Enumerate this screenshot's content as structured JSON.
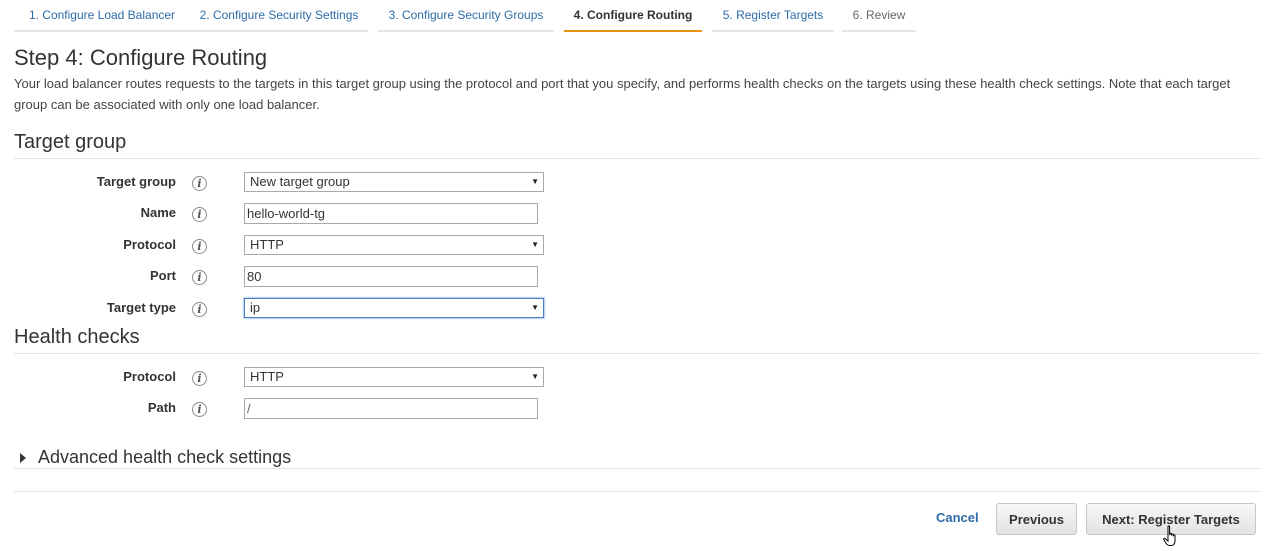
{
  "wizard": {
    "tabs": [
      {
        "label": "1. Configure Load Balancer",
        "state": "done"
      },
      {
        "label": "2. Configure Security Settings",
        "state": "done"
      },
      {
        "label": "3. Configure Security Groups",
        "state": "done"
      },
      {
        "label": "4. Configure Routing",
        "state": "active"
      },
      {
        "label": "5. Register Targets",
        "state": "next"
      },
      {
        "label": "6. Review",
        "state": "disabled"
      }
    ]
  },
  "page": {
    "title": "Step 4: Configure Routing",
    "description": "Your load balancer routes requests to the targets in this target group using the protocol and port that you specify, and performs health checks on the targets using these health check settings. Note that each target group can be associated with only one load balancer."
  },
  "target_group": {
    "section_title": "Target group",
    "fields": {
      "target_group": {
        "label": "Target group",
        "value": "New target group"
      },
      "name": {
        "label": "Name",
        "value": "hello-world-tg"
      },
      "protocol": {
        "label": "Protocol",
        "value": "HTTP"
      },
      "port": {
        "label": "Port",
        "value": "80"
      },
      "target_type": {
        "label": "Target type",
        "value": "ip"
      }
    }
  },
  "health_checks": {
    "section_title": "Health checks",
    "fields": {
      "protocol": {
        "label": "Protocol",
        "value": "HTTP"
      },
      "path": {
        "label": "Path",
        "value": "/"
      }
    },
    "advanced_label": "Advanced health check settings"
  },
  "footer": {
    "cancel_label": "Cancel",
    "previous_label": "Previous",
    "next_label": "Next: Register Targets"
  },
  "icons": {
    "info": "info-icon",
    "dropdown": "chevron-down-icon",
    "expand": "caret-right-icon",
    "cursor": "hand-pointer-icon"
  },
  "colors": {
    "link": "#2e6ca8",
    "active_tab_accent": "#e8940f",
    "focus_border": "#4a7ec2"
  },
  "glyphs": {
    "info": "i",
    "dropdown": "▼"
  }
}
